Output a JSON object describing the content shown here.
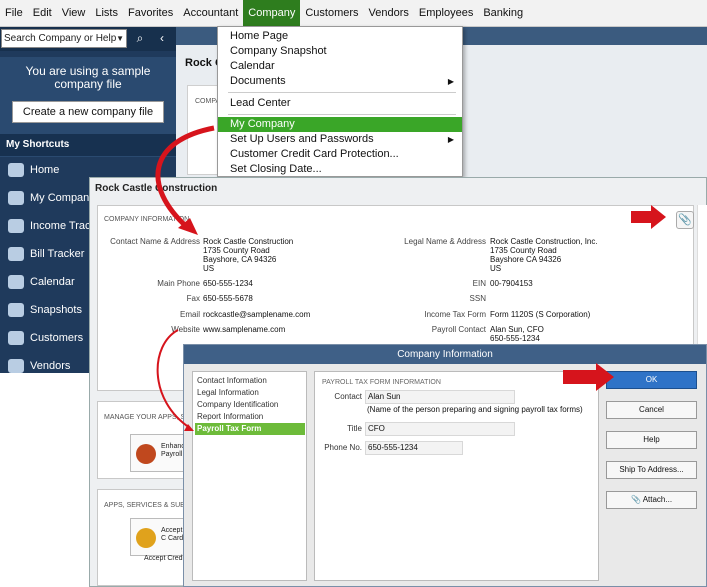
{
  "menubar": {
    "items": [
      "File",
      "Edit",
      "View",
      "Lists",
      "Favorites",
      "Accountant",
      "Company",
      "Customers",
      "Vendors",
      "Employees",
      "Banking"
    ],
    "active_index": 6
  },
  "sidebar": {
    "search_placeholder": "Search Company or Help",
    "search_icon": "magnifier-icon",
    "collapse_icon": "chevron-left-icon",
    "sample_text": "You are using a sample company file",
    "create_button": "Create a new company file",
    "shortcuts_header": "My Shortcuts",
    "shortcuts": [
      "Home",
      "My Company",
      "Income Tracker",
      "Bill Tracker",
      "Calendar",
      "Snapshots",
      "Customers",
      "Vendors"
    ]
  },
  "behind": {
    "company_title": "Rock C",
    "company_info_fragment": "COMPA"
  },
  "company_menu": {
    "items": [
      {
        "label": "Home Page",
        "submenu": false
      },
      {
        "label": "Company Snapshot",
        "submenu": false
      },
      {
        "label": "Calendar",
        "submenu": false
      },
      {
        "label": "Documents",
        "submenu": true
      },
      {
        "label": "Lead Center",
        "submenu": false
      },
      {
        "label": "My Company",
        "submenu": false,
        "highlighted": true
      },
      {
        "label": "Set Up Users and Passwords",
        "submenu": true
      },
      {
        "label": "Customer Credit Card Protection...",
        "submenu": false
      },
      {
        "label": "Set Closing Date...",
        "submenu": false
      }
    ]
  },
  "company_page": {
    "title": "Rock Castle Construction",
    "section_header": "COMPANY INFORMATION",
    "labels": {
      "contact_name_address": "Contact Name & Address",
      "main_phone": "Main Phone",
      "fax": "Fax",
      "email": "Email",
      "website": "Website",
      "legal_name_address": "Legal Name & Address",
      "ein": "EIN",
      "ssn": "SSN",
      "income_tax_form": "Income Tax Form",
      "payroll_contact": "Payroll Contact"
    },
    "values": {
      "contact_line1": "Rock Castle Construction",
      "contact_line2": "1735 County Road",
      "contact_line3": "Bayshore, CA 94326",
      "contact_line4": "US",
      "main_phone": "650-555-1234",
      "fax": "650-555-5678",
      "email": "rockcastle@samplename.com",
      "website": "www.samplename.com",
      "legal_line1": "Rock Castle Construction, Inc.",
      "legal_line2": "1735 County Road",
      "legal_line3": "Bayshore CA 94326",
      "legal_line4": "US",
      "ein": "00-7904153",
      "ssn": "",
      "income_tax_form": "Form 1120S (S Corporation)",
      "payroll_contact_line1": "Alan Sun, CFO",
      "payroll_contact_line2": "650-555-1234"
    },
    "manage_header": "MANAGE YOUR APPS, SE",
    "manage_service": "Enhance Payroll",
    "apps_header": "APPS, SERVICES & SUBSC",
    "apps_service": "Accept C Cards",
    "apps_caption": "Accept Credit C",
    "attach_icon": "paperclip-icon",
    "colors": {
      "manage_icon": "#c0481e",
      "apps_icon": "#e0a21c"
    }
  },
  "dialog": {
    "title": "Company Information",
    "nav_items": [
      "Contact Information",
      "Legal Information",
      "Company Identification",
      "Report Information",
      "Payroll Tax Form Information"
    ],
    "selected_nav_index": 4,
    "panel_header": "PAYROLL TAX FORM INFORMATION",
    "contact_label": "Contact",
    "contact_value": "Alan Sun",
    "contact_note": "(Name of the person preparing and signing payroll tax forms)",
    "title_label": "Title",
    "title_value": "CFO",
    "phone_label": "Phone No.",
    "phone_value": "650-555-1234",
    "buttons": {
      "ok": "OK",
      "cancel": "Cancel",
      "help": "Help",
      "ship_to": "Ship To Address...",
      "attach": "Attach..."
    }
  },
  "colors": {
    "menu_active": "#2e7d1e",
    "menu_highlight": "#3aa628",
    "sidebar_bg": "#1f3a5c",
    "dialog_caption": "#3f6087",
    "ok_button": "#2f73c7",
    "arrow": "#d6141c"
  }
}
